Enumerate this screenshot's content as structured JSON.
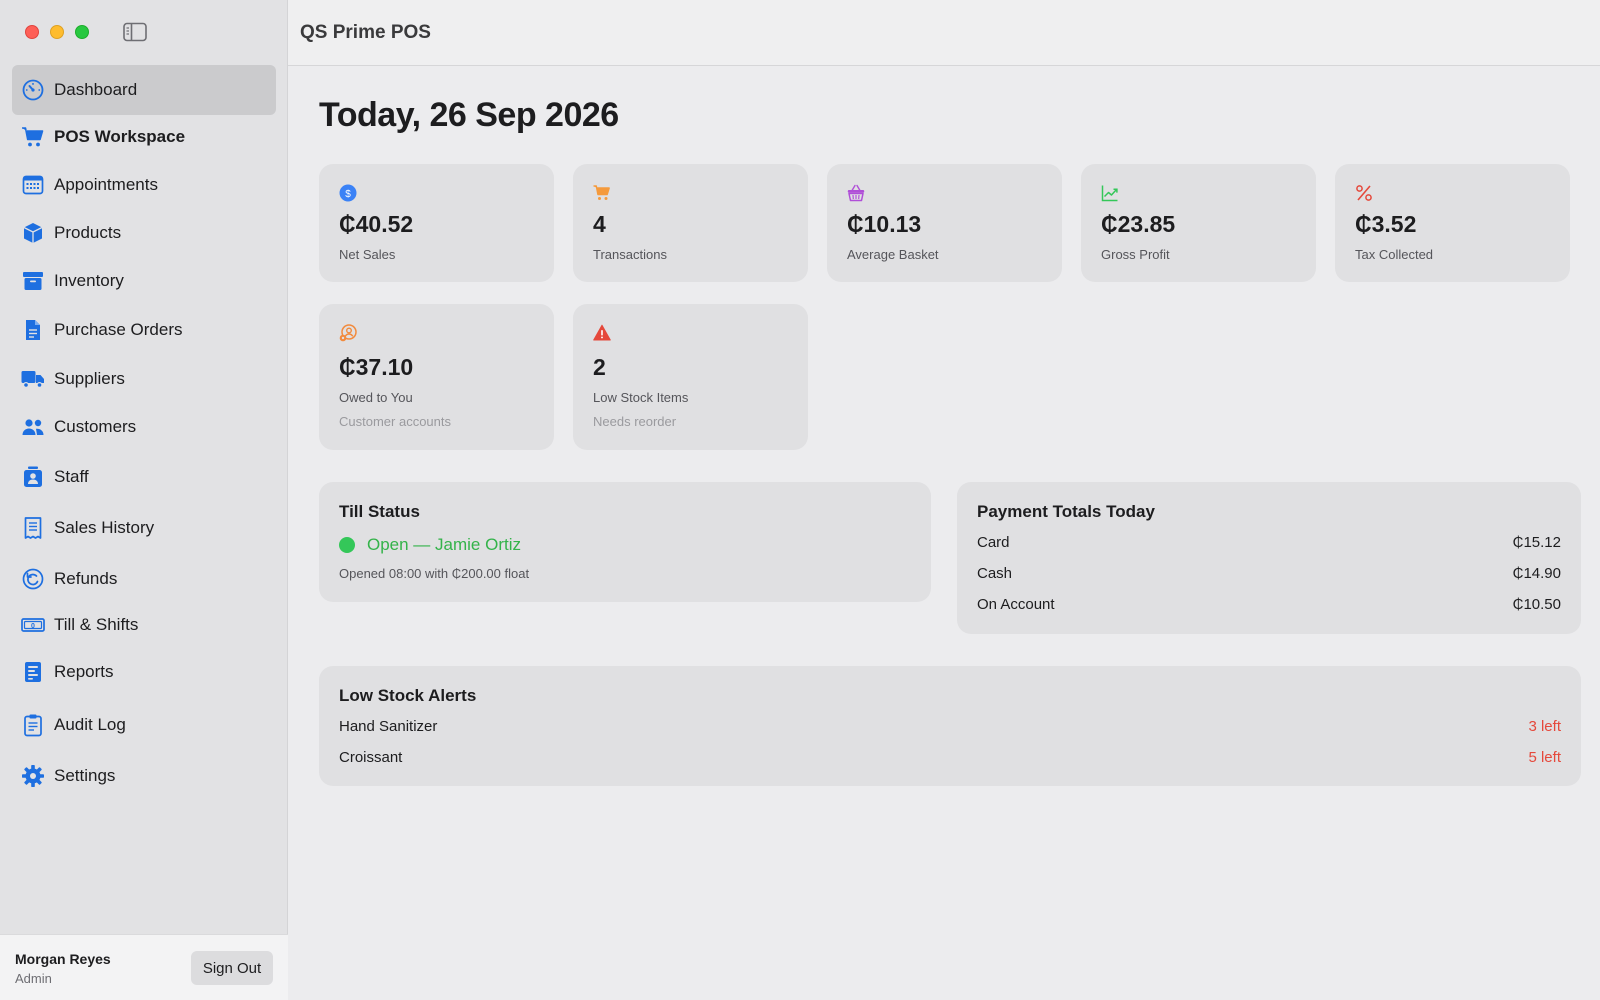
{
  "window": {
    "app_title": "QS Prime POS"
  },
  "sidebar": {
    "items": [
      {
        "label": "Dashboard",
        "icon": "dashboard-gauge-icon",
        "active": true
      },
      {
        "label": "POS Workspace",
        "icon": "cart-icon",
        "bold": true
      },
      {
        "label": "Appointments",
        "icon": "calendar-icon"
      },
      {
        "label": "Products",
        "icon": "box-icon"
      },
      {
        "label": "Inventory",
        "icon": "archive-box-icon"
      },
      {
        "label": "Purchase Orders",
        "icon": "document-icon"
      },
      {
        "label": "Suppliers",
        "icon": "truck-icon"
      },
      {
        "label": "Customers",
        "icon": "people-icon"
      },
      {
        "label": "Staff",
        "icon": "id-badge-icon"
      },
      {
        "label": "Sales History",
        "icon": "receipt-icon"
      },
      {
        "label": "Refunds",
        "icon": "refund-arrow-icon"
      },
      {
        "label": "Till & Shifts",
        "icon": "banknote-icon"
      },
      {
        "label": "Reports",
        "icon": "report-icon"
      },
      {
        "label": "Audit Log",
        "icon": "clipboard-icon"
      },
      {
        "label": "Settings",
        "icon": "gear-icon"
      }
    ],
    "user": {
      "name": "Morgan Reyes",
      "role": "Admin",
      "sign_out_label": "Sign Out"
    }
  },
  "main": {
    "title": "Today, 26 Sep 2026",
    "stats": [
      {
        "value": "₵40.52",
        "label": "Net Sales",
        "icon": "dollar-circle-icon",
        "color": "#3b82f6"
      },
      {
        "value": "4",
        "label": "Transactions",
        "icon": "cart-icon",
        "color": "#f59a3c"
      },
      {
        "value": "₵10.13",
        "label": "Average Basket",
        "icon": "basket-icon",
        "color": "#b04fd8"
      },
      {
        "value": "₵23.85",
        "label": "Gross Profit",
        "icon": "trend-chart-icon",
        "color": "#34c759"
      },
      {
        "value": "₵3.52",
        "label": "Tax Collected",
        "icon": "percent-icon",
        "color": "#e5483b"
      },
      {
        "value": "₵37.10",
        "label": "Owed to You",
        "sub": "Customer accounts",
        "icon": "person-circle-icon",
        "color": "#f28a3c"
      },
      {
        "value": "2",
        "label": "Low Stock Items",
        "sub": "Needs reorder",
        "icon": "warning-triangle-icon",
        "color": "#e5483b"
      }
    ],
    "till": {
      "title": "Till Status",
      "status": "Open — Jamie Ortiz",
      "note": "Opened 08:00 with ₵200.00 float"
    },
    "payments": {
      "title": "Payment Totals Today",
      "rows": [
        {
          "method": "Card",
          "amount": "₵15.12"
        },
        {
          "method": "Cash",
          "amount": "₵14.90"
        },
        {
          "method": "On Account",
          "amount": "₵10.50"
        }
      ]
    },
    "low_stock": {
      "title": "Low Stock Alerts",
      "rows": [
        {
          "item": "Hand Sanitizer",
          "qty": "3 left"
        },
        {
          "item": "Croissant",
          "qty": "5 left"
        }
      ]
    }
  }
}
